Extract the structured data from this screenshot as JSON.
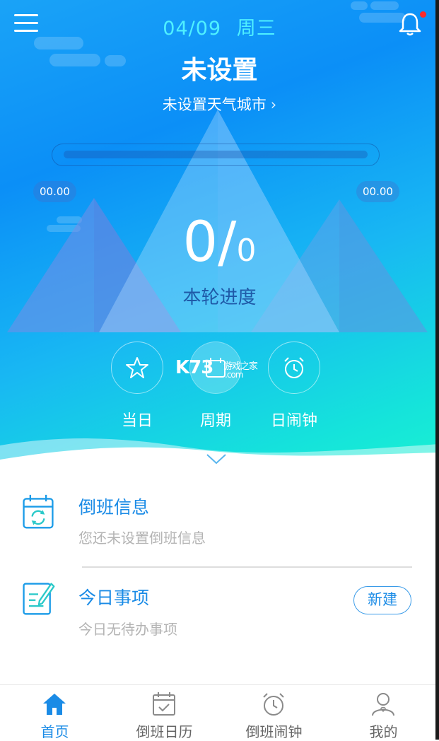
{
  "header": {
    "date": "04/09",
    "weekday": "周三",
    "title": "未设置",
    "city_link": "未设置天气城市",
    "chevron": "›"
  },
  "progress": {
    "left_value": "00.00",
    "right_value": "00.00",
    "current": "0",
    "slash": "/",
    "total": "0",
    "label": "本轮进度",
    "bar_fraction": 0
  },
  "modes": [
    {
      "label": "当日",
      "icon": "star-icon"
    },
    {
      "label": "周期",
      "icon": "calendar-icon"
    },
    {
      "label": "日闹钟",
      "icon": "alarm-clock-icon"
    }
  ],
  "watermark": {
    "brand": "K73",
    "cn": "游戏之家",
    "domain": ".com"
  },
  "shift_info": {
    "title": "倒班信息",
    "subtitle": "您还未设置倒班信息",
    "icon": "calendar-sync-icon"
  },
  "today_items": {
    "title": "今日事项",
    "subtitle": "今日无待办事项",
    "button": "新建",
    "icon": "note-edit-icon"
  },
  "tabs": [
    {
      "label": "首页",
      "icon": "home-icon",
      "active": true
    },
    {
      "label": "倒班日历",
      "icon": "calendar-check-icon",
      "active": false
    },
    {
      "label": "倒班闹钟",
      "icon": "alarm-icon",
      "active": false
    },
    {
      "label": "我的",
      "icon": "user-icon",
      "active": false
    }
  ],
  "colors": {
    "accent": "#1a8be6",
    "date": "#4ff0ff",
    "notification_dot": "#ff2a2a"
  }
}
